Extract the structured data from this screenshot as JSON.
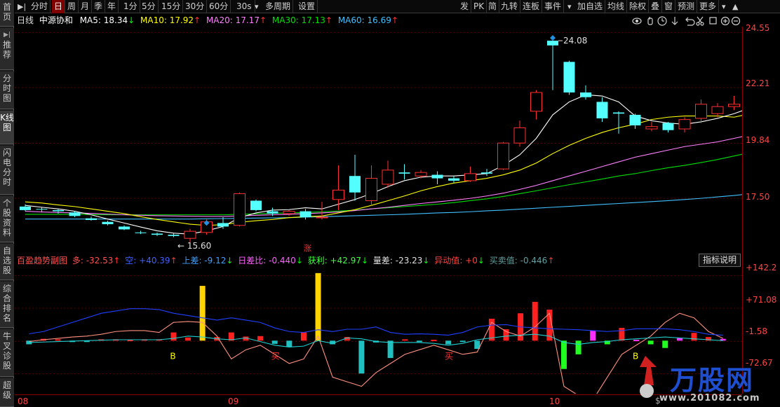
{
  "sidebar": {
    "items": [
      {
        "label": "首页"
      },
      {
        "label": "推荐"
      },
      {
        "label": "分时图"
      },
      {
        "label": "K线图"
      },
      {
        "label": "闪电分时"
      },
      {
        "label": "个股资料"
      },
      {
        "label": "自选股"
      },
      {
        "label": "综合排名"
      },
      {
        "label": "牛叉诊股"
      },
      {
        "label": "超级"
      }
    ]
  },
  "toolbar": {
    "left": [
      "分时",
      "日",
      "周",
      "月",
      "季",
      "年",
      "1分",
      "5分",
      "15分",
      "30分",
      "60分",
      "30s",
      "多周期",
      "设置"
    ],
    "selected": "日",
    "right": [
      "发",
      "PK",
      "简",
      "九转",
      "连板",
      "事件",
      "加自选",
      "均线",
      "除权",
      "叠",
      "窗",
      "预测",
      "更多"
    ]
  },
  "ma": {
    "period": "日线",
    "stock": "中源协和",
    "ma5_label": "MA5: 18.34",
    "ma5_arrow": "↓",
    "ma10_label": "MA10: 17.92",
    "ma10_arrow": "↑",
    "ma20_label": "MA20: 17.17",
    "ma20_arrow": "↑",
    "ma30_label": "MA30: 17.13",
    "ma30_arrow": "↑",
    "ma60_label": "MA60: 16.69",
    "ma60_arrow": "↑",
    "colors": {
      "ma5": "#ffffff",
      "ma10": "#ffff00",
      "ma20": "#ff80ff",
      "ma30": "#00e000",
      "ma60": "#40c0ff"
    }
  },
  "price_axis": [
    "24.55",
    "22.21",
    "19.84",
    "17.50"
  ],
  "annotations": {
    "high": "24.08",
    "low": "← 15.60",
    "zhang": "涨"
  },
  "indicator": {
    "name": "百盈趋势副图",
    "duo": "多: -32.53",
    "duo_arrow": "↑",
    "kong": "空: +40.39",
    "kong_arrow": "↑",
    "shangcha": "上差: -9.12",
    "shangcha_arrow": "↓",
    "richabi": "日差比: -0.440",
    "richabi_arrow": "↓",
    "huoli": "获利: +42.97",
    "huoli_arrow": "↓",
    "liangcha": "量差: -23.23",
    "liangcha_arrow": "↓",
    "yidong": "异动值: +0",
    "yidong_arrow": "↓",
    "maimaizhi": "买卖值: -0.446",
    "maimaizhi_arrow": "↑",
    "button": "指标说明",
    "axis": [
      "+142.2",
      "+71.08",
      "-1.58",
      "-72.67"
    ],
    "signals": {
      "b": "B",
      "buy": "买"
    }
  },
  "time_axis": [
    "08",
    "09",
    "10"
  ],
  "watermark": {
    "brand": "万股网",
    "url": "www.201082.com"
  },
  "toolbar_icons": [
    "eye-icon",
    "hand-icon",
    "clock-icon",
    "arrow-down-icon",
    "undo-icon",
    "scissors-icon",
    "select-icon",
    "zoom-in-icon",
    "zoom-out-icon"
  ],
  "chart_data": {
    "type": "candlestick",
    "colors": {
      "up": "#ff3030",
      "down": "#54ffff"
    },
    "candles": [
      {
        "o": 17.15,
        "h": 17.25,
        "l": 16.95,
        "c": 17.0
      },
      {
        "o": 17.05,
        "h": 17.1,
        "l": 16.9,
        "c": 17.02
      },
      {
        "o": 17.0,
        "h": 17.05,
        "l": 16.85,
        "c": 16.95
      },
      {
        "o": 16.9,
        "h": 16.95,
        "l": 16.7,
        "c": 16.75
      },
      {
        "o": 16.65,
        "h": 16.72,
        "l": 16.55,
        "c": 16.58
      },
      {
        "o": 16.5,
        "h": 16.55,
        "l": 16.35,
        "c": 16.4
      },
      {
        "o": 16.3,
        "h": 16.35,
        "l": 16.15,
        "c": 16.18
      },
      {
        "o": 16.05,
        "h": 16.12,
        "l": 15.98,
        "c": 16.02
      },
      {
        "o": 16.0,
        "h": 16.05,
        "l": 15.9,
        "c": 15.95
      },
      {
        "o": 15.95,
        "h": 16.0,
        "l": 15.85,
        "c": 15.9
      },
      {
        "o": 15.8,
        "h": 16.2,
        "l": 15.6,
        "c": 16.1
      },
      {
        "o": 16.05,
        "h": 16.6,
        "l": 15.95,
        "c": 16.5
      },
      {
        "o": 16.45,
        "h": 16.7,
        "l": 16.2,
        "c": 16.3
      },
      {
        "o": 16.35,
        "h": 17.75,
        "l": 16.3,
        "c": 17.7
      },
      {
        "o": 17.4,
        "h": 17.45,
        "l": 16.95,
        "c": 17.0
      },
      {
        "o": 16.95,
        "h": 17.1,
        "l": 16.75,
        "c": 16.85
      },
      {
        "o": 16.85,
        "h": 17.0,
        "l": 16.75,
        "c": 16.95
      },
      {
        "o": 16.95,
        "h": 17.05,
        "l": 16.6,
        "c": 16.7
      },
      {
        "o": 16.7,
        "h": 17.35,
        "l": 16.6,
        "c": 16.7
      },
      {
        "o": 17.45,
        "h": 18.9,
        "l": 17.0,
        "c": 17.85
      },
      {
        "o": 18.45,
        "h": 19.35,
        "l": 17.4,
        "c": 17.75
      },
      {
        "o": 17.4,
        "h": 18.9,
        "l": 17.2,
        "c": 18.35
      },
      {
        "o": 18.1,
        "h": 19.1,
        "l": 17.95,
        "c": 18.7
      },
      {
        "o": 18.6,
        "h": 18.95,
        "l": 18.3,
        "c": 18.55
      },
      {
        "o": 18.45,
        "h": 18.7,
        "l": 18.35,
        "c": 18.6
      },
      {
        "o": 18.5,
        "h": 18.65,
        "l": 18.1,
        "c": 18.35
      },
      {
        "o": 18.35,
        "h": 18.45,
        "l": 18.15,
        "c": 18.25
      },
      {
        "o": 18.25,
        "h": 18.85,
        "l": 18.2,
        "c": 18.55
      },
      {
        "o": 18.6,
        "h": 18.75,
        "l": 18.45,
        "c": 18.55
      },
      {
        "o": 18.75,
        "h": 19.9,
        "l": 18.7,
        "c": 19.85
      },
      {
        "o": 19.85,
        "h": 20.8,
        "l": 19.7,
        "c": 20.5
      },
      {
        "o": 21.2,
        "h": 22.1,
        "l": 20.85,
        "c": 22.0
      },
      {
        "o": 24.2,
        "h": 24.2,
        "l": 22.1,
        "c": 24.0
      },
      {
        "o": 23.3,
        "h": 23.35,
        "l": 21.9,
        "c": 22.0
      },
      {
        "o": 22.0,
        "h": 22.3,
        "l": 21.7,
        "c": 21.8
      },
      {
        "o": 21.6,
        "h": 21.8,
        "l": 20.75,
        "c": 20.9
      },
      {
        "o": 21.15,
        "h": 21.2,
        "l": 20.25,
        "c": 21.1
      },
      {
        "o": 21.05,
        "h": 21.1,
        "l": 20.45,
        "c": 20.6
      },
      {
        "o": 20.45,
        "h": 20.75,
        "l": 20.35,
        "c": 20.55
      },
      {
        "o": 20.7,
        "h": 20.75,
        "l": 20.3,
        "c": 20.4
      },
      {
        "o": 20.45,
        "h": 20.95,
        "l": 20.3,
        "c": 20.85
      },
      {
        "o": 20.9,
        "h": 21.7,
        "l": 20.7,
        "c": 21.5
      },
      {
        "o": 21.1,
        "h": 21.55,
        "l": 20.95,
        "c": 21.4
      },
      {
        "o": 21.4,
        "h": 21.85,
        "l": 21.25,
        "c": 21.5
      },
      {
        "o": 21.65,
        "h": 22.2,
        "l": 21.55,
        "c": 21.95
      }
    ],
    "ma": {
      "ma5": [
        17.2,
        17.12,
        17.05,
        16.95,
        16.8,
        16.62,
        16.45,
        16.28,
        16.12,
        16.02,
        15.98,
        16.12,
        16.3,
        16.68,
        16.88,
        17.0,
        17.02,
        17.1,
        17.05,
        17.25,
        17.45,
        17.7,
        18.0,
        18.25,
        18.4,
        18.45,
        18.45,
        18.5,
        18.55,
        18.9,
        19.35,
        20.05,
        21.05,
        21.6,
        21.9,
        21.85,
        21.6,
        21.0,
        20.8,
        20.7,
        20.65,
        20.75,
        20.9,
        21.1,
        21.35
      ],
      "ma10": [
        17.35,
        17.3,
        17.22,
        17.15,
        17.05,
        16.95,
        16.85,
        16.72,
        16.6,
        16.5,
        16.4,
        16.35,
        16.38,
        16.48,
        16.55,
        16.6,
        16.68,
        16.72,
        16.75,
        16.88,
        17.02,
        17.2,
        17.4,
        17.6,
        17.82,
        18.0,
        18.15,
        18.25,
        18.35,
        18.5,
        18.7,
        19.0,
        19.4,
        19.75,
        20.05,
        20.3,
        20.5,
        20.65,
        20.85,
        20.95,
        21.0,
        21.0,
        21.0,
        20.95,
        21.1
      ],
      "ma20": [
        16.95,
        16.92,
        16.9,
        16.88,
        16.86,
        16.83,
        16.8,
        16.78,
        16.76,
        16.75,
        16.74,
        16.73,
        16.73,
        16.75,
        16.78,
        16.8,
        16.82,
        16.85,
        16.88,
        16.92,
        16.98,
        17.05,
        17.12,
        17.2,
        17.28,
        17.35,
        17.42,
        17.5,
        17.6,
        17.72,
        17.88,
        18.05,
        18.25,
        18.45,
        18.65,
        18.85,
        19.05,
        19.25,
        19.4,
        19.55,
        19.7,
        19.8,
        19.9,
        20.05,
        20.2
      ],
      "ma30": [
        16.82,
        16.82,
        16.82,
        16.82,
        16.81,
        16.8,
        16.8,
        16.8,
        16.8,
        16.8,
        16.8,
        16.8,
        16.8,
        16.82,
        16.84,
        16.86,
        16.88,
        16.9,
        16.93,
        16.96,
        17.0,
        17.05,
        17.1,
        17.15,
        17.2,
        17.25,
        17.32,
        17.4,
        17.48,
        17.58,
        17.7,
        17.82,
        17.95,
        18.08,
        18.2,
        18.32,
        18.45,
        18.55,
        18.68,
        18.8,
        18.9,
        19.02,
        19.15,
        19.3,
        19.45
      ],
      "ma60": [
        16.62,
        16.62,
        16.62,
        16.62,
        16.62,
        16.62,
        16.62,
        16.62,
        16.62,
        16.62,
        16.62,
        16.63,
        16.64,
        16.65,
        16.66,
        16.67,
        16.68,
        16.7,
        16.72,
        16.74,
        16.76,
        16.78,
        16.8,
        16.82,
        16.85,
        16.88,
        16.9,
        16.93,
        16.97,
        17.0,
        17.04,
        17.08,
        17.12,
        17.16,
        17.2,
        17.24,
        17.28,
        17.32,
        17.36,
        17.4,
        17.45,
        17.5,
        17.56,
        17.62,
        17.7
      ]
    },
    "sub": {
      "bars": [
        -8,
        4,
        3,
        -3,
        -3,
        3,
        3,
        2,
        3,
        3,
        18,
        7,
        120,
        8,
        18,
        9,
        10,
        -7,
        -14,
        18,
        148,
        -8,
        8,
        -72,
        -4,
        -38,
        3,
        -2,
        2,
        -8,
        -2,
        -18,
        48,
        25,
        60,
        85,
        68,
        -62,
        -30,
        22,
        -8,
        28,
        2,
        -8,
        -16,
        6,
        17,
        8,
        4
      ],
      "blue": [
        15,
        20,
        30,
        40,
        50,
        60,
        65,
        70,
        70,
        68,
        60,
        55,
        50,
        45,
        50,
        45,
        40,
        28,
        20,
        18,
        24,
        20,
        25,
        25,
        30,
        18,
        14,
        15,
        14,
        12,
        18,
        30,
        34,
        35,
        30,
        28,
        26,
        25,
        24,
        22,
        20,
        22,
        26,
        26,
        26,
        24,
        20,
        14,
        12
      ],
      "salmon": [
        -2,
        2,
        5,
        8,
        10,
        14,
        20,
        22,
        22,
        18,
        40,
        42,
        40,
        10,
        -40,
        -20,
        -10,
        -30,
        -50,
        -40,
        10,
        -80,
        -90,
        -100,
        -70,
        -50,
        -30,
        -20,
        -10,
        -20,
        -30,
        -25,
        40,
        20,
        10,
        30,
        60,
        -100,
        -120,
        -130,
        -80,
        -30,
        -10,
        10,
        40,
        60,
        50,
        20,
        5
      ],
      "cyan": [
        -4,
        -3,
        -2,
        -1,
        0,
        1,
        2,
        2,
        2,
        2,
        5,
        10,
        8,
        4,
        2,
        6,
        -2,
        -10,
        -14,
        -12,
        0,
        -6,
        6,
        4,
        -2,
        -4,
        -4,
        -4,
        -6,
        -10,
        -6,
        2,
        6,
        10,
        12,
        14,
        10,
        -4,
        -8,
        -4,
        -2,
        2,
        4,
        6,
        8,
        6,
        4,
        2,
        0
      ],
      "ylim": [
        -110,
        160
      ]
    }
  }
}
